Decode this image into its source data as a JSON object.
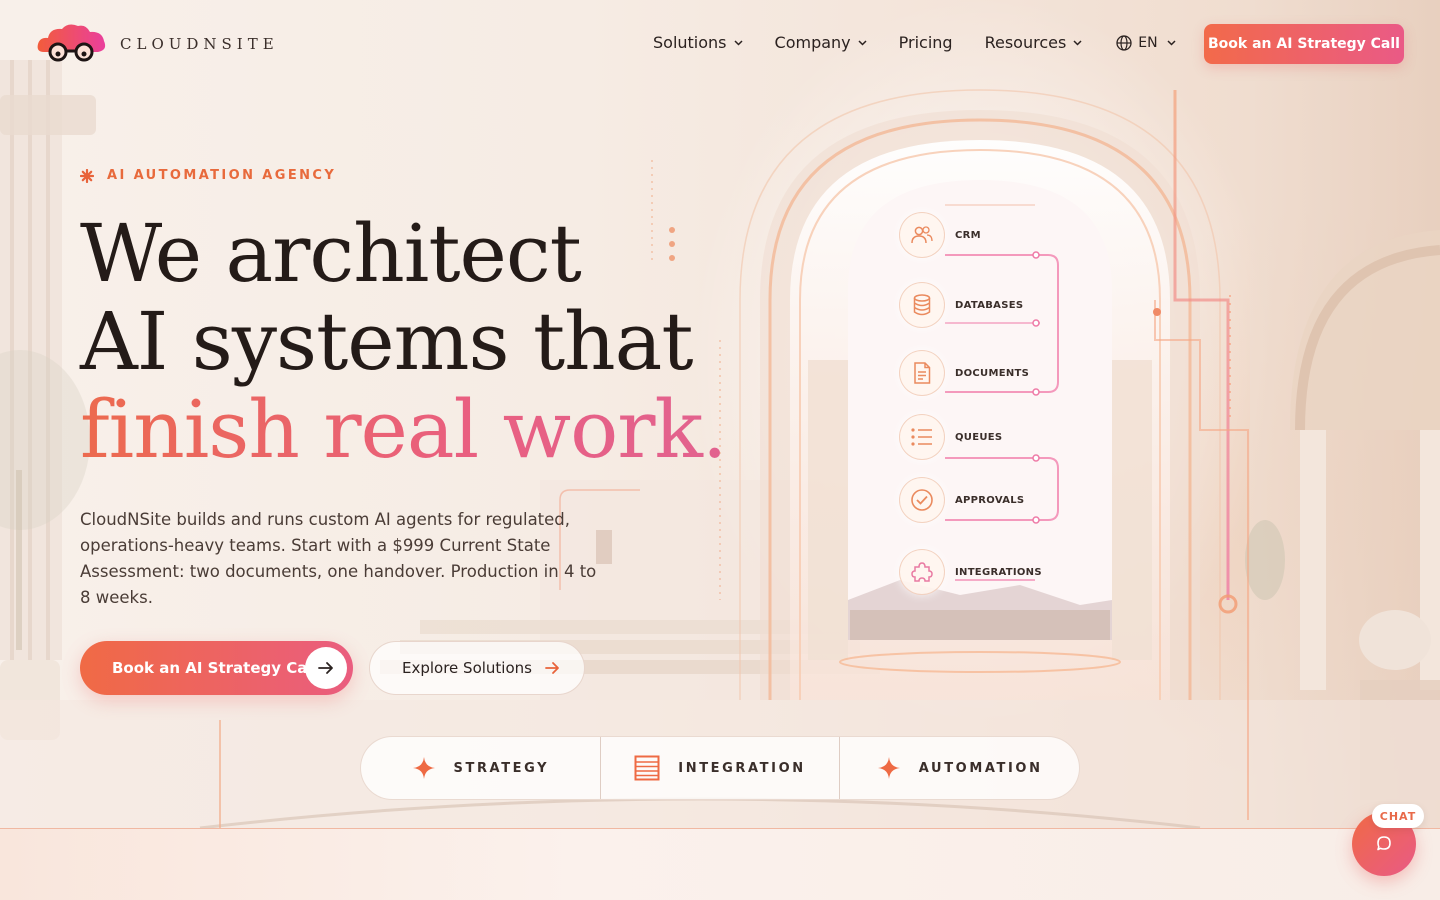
{
  "brand": {
    "name": "CLOUDNSITE"
  },
  "nav": {
    "items": [
      {
        "label": "Solutions",
        "has_dropdown": true
      },
      {
        "label": "Company",
        "has_dropdown": true
      },
      {
        "label": "Pricing",
        "has_dropdown": false
      },
      {
        "label": "Resources",
        "has_dropdown": true
      }
    ],
    "language": "EN",
    "cta": "Book an AI Strategy Call"
  },
  "hero": {
    "eyebrow": "AI AUTOMATION AGENCY",
    "headline_line1": "We architect",
    "headline_line2": "AI systems that",
    "headline_accent": "finish real work.",
    "subtext": "CloudNSite builds and runs custom AI agents for regulated, operations-heavy teams. Start with a $999 Current State Assessment: two documents, one handover. Production in 4 to 8 weeks.",
    "primary_button": "Book an AI Strategy Call",
    "secondary_button": "Explore Solutions"
  },
  "pillars": [
    {
      "label": "STRATEGY",
      "icon": "sparkle-icon"
    },
    {
      "label": "INTEGRATION",
      "icon": "stack-lines-icon"
    },
    {
      "label": "AUTOMATION",
      "icon": "sparkle-icon"
    }
  ],
  "systems": [
    {
      "label": "CRM",
      "icon": "users-icon"
    },
    {
      "label": "DATABASES",
      "icon": "database-icon"
    },
    {
      "label": "DOCUMENTS",
      "icon": "document-icon"
    },
    {
      "label": "QUEUES",
      "icon": "list-icon"
    },
    {
      "label": "APPROVALS",
      "icon": "check-circle-icon"
    },
    {
      "label": "INTEGRATIONS",
      "icon": "puzzle-icon"
    }
  ],
  "chat": {
    "label": "CHAT"
  },
  "colors": {
    "accent_orange": "#f06a45",
    "accent_pink": "#ea5d7f",
    "text_dark": "#241b18",
    "background": "#f7efe9"
  }
}
